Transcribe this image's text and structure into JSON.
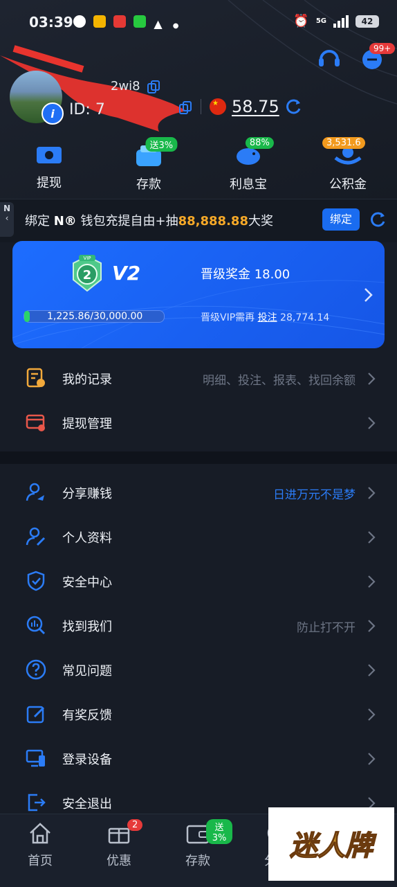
{
  "status": {
    "time": "03:39",
    "battery": "42",
    "network": "5G"
  },
  "header": {
    "username": "2wi8",
    "user_id": "ID: 7",
    "balance": "58.75",
    "messages_badge": "99+"
  },
  "quick_actions": [
    {
      "label": "提现",
      "icon": "withdraw-icon"
    },
    {
      "label": "存款",
      "icon": "deposit-icon",
      "badge": "送3%",
      "badge_color": "#19b84a"
    },
    {
      "label": "利息宝",
      "icon": "piggy-bank-icon",
      "badge": "88%",
      "badge_color": "#19b84a"
    },
    {
      "label": "公积金",
      "icon": "fund-icon",
      "badge": "3,531.6",
      "badge_color": "#f29a1e"
    }
  ],
  "bind_banner": {
    "side_tab": "N",
    "prefix": "绑定 ",
    "brand": "N®",
    "middle": " 钱包充提自由+抽",
    "amount": "88,888.88",
    "suffix": "大奖",
    "button": "绑定"
  },
  "vip": {
    "badge": "VIP",
    "badge_level": "2",
    "level": "V2",
    "bonus": "晋级奖金 18.00",
    "progress_text": "1,225.86/30,000.00",
    "progress_fraction": 0.041,
    "need_prefix": "晋级VIP需再 ",
    "need_link": "投注",
    "need_amount": " 28,774.14"
  },
  "menu_top": [
    {
      "label": "我的记录",
      "hint": "明细、投注、报表、找回余额",
      "icon": "records-icon"
    },
    {
      "label": "提现管理",
      "hint": "",
      "icon": "withdraw-manage-icon"
    }
  ],
  "menu_main": [
    {
      "label": "分享赚钱",
      "hint": "日进万元不是梦",
      "icon": "share-user-icon"
    },
    {
      "label": "个人资料",
      "hint": "",
      "icon": "profile-edit-icon"
    },
    {
      "label": "安全中心",
      "hint": "",
      "icon": "shield-check-icon"
    },
    {
      "label": "找到我们",
      "hint": "防止打不开",
      "icon": "find-us-icon"
    },
    {
      "label": "常见问题",
      "hint": "",
      "icon": "question-icon"
    },
    {
      "label": "有奖反馈",
      "hint": "",
      "icon": "feedback-icon"
    },
    {
      "label": "登录设备",
      "hint": "",
      "icon": "devices-icon"
    },
    {
      "label": "安全退出",
      "hint": "",
      "icon": "logout-icon"
    }
  ],
  "bottom_nav": [
    {
      "label": "首页",
      "icon": "home-icon"
    },
    {
      "label": "优惠",
      "icon": "gift-icon",
      "badge": "2"
    },
    {
      "label": "存款",
      "icon": "wallet-icon",
      "badge": "送3%"
    },
    {
      "label": "分享",
      "icon": "share-icon"
    }
  ],
  "watermark": "迷人牌",
  "colors": {
    "accent": "#1a6cf0",
    "gold": "#f7a928",
    "background": "#171c26"
  }
}
